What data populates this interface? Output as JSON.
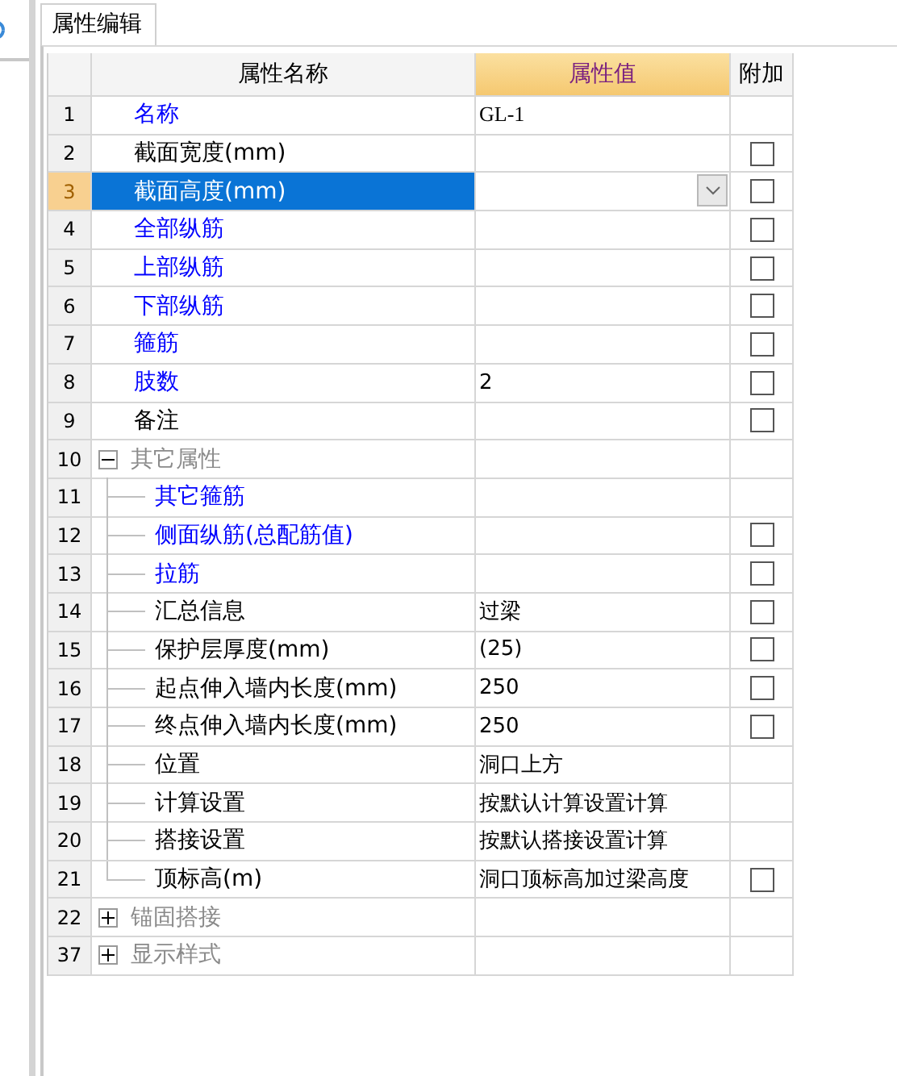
{
  "tab": {
    "label": "属性编辑",
    "selected": true
  },
  "table": {
    "columns": [
      {
        "label": "属性名称",
        "highlighted": false
      },
      {
        "label": "属性值",
        "highlighted": true
      },
      {
        "label": "附加",
        "highlighted": false
      }
    ],
    "rows": [
      {
        "kind": "item",
        "number": "1",
        "name": "名称",
        "color": "#0000ff",
        "value": "GL-1",
        "selected": false
      },
      {
        "kind": "item",
        "number": "2",
        "name": "截面宽度(mm)",
        "color": "#000000",
        "checked": false,
        "selected": false
      },
      {
        "kind": "item",
        "number": "3",
        "name": "截面高度(mm)",
        "checked": false,
        "selected": true,
        "dropdown": true
      },
      {
        "kind": "item",
        "number": "4",
        "name": "全部纵筋",
        "color": "#0000ff",
        "checked": false,
        "selected": false
      },
      {
        "kind": "item",
        "number": "5",
        "name": "上部纵筋",
        "color": "#0000ff",
        "checked": false,
        "selected": false
      },
      {
        "kind": "item",
        "number": "6",
        "name": "下部纵筋",
        "color": "#0000ff",
        "checked": false,
        "selected": false
      },
      {
        "kind": "item",
        "number": "7",
        "name": "箍筋",
        "color": "#0000ff",
        "checked": false,
        "selected": false
      },
      {
        "kind": "item",
        "number": "8",
        "name": "肢数",
        "color": "#0000ff",
        "value": "2",
        "checked": false,
        "selected": false
      },
      {
        "kind": "item",
        "number": "9",
        "name": "备注",
        "color": "#000000",
        "checked": false,
        "selected": false
      },
      {
        "kind": "group",
        "number": "10",
        "name": "其它属性",
        "expanded": true,
        "selected": false,
        "children": [
          {
            "kind": "item",
            "number": "11",
            "name": "其它箍筋",
            "color": "#0000ff",
            "selected": false
          },
          {
            "kind": "item",
            "number": "12",
            "name": "侧面纵筋(总配筋值)",
            "color": "#0000ff",
            "checked": false,
            "selected": false
          },
          {
            "kind": "item",
            "number": "13",
            "name": "拉筋",
            "color": "#0000ff",
            "checked": false,
            "selected": false
          },
          {
            "kind": "item",
            "number": "14",
            "name": "汇总信息",
            "color": "#000000",
            "value": "过梁",
            "checked": false,
            "selected": false
          },
          {
            "kind": "item",
            "number": "15",
            "name": "保护层厚度(mm)",
            "color": "#000000",
            "value": "(25)",
            "checked": false,
            "selected": false
          },
          {
            "kind": "item",
            "number": "16",
            "name": "起点伸入墙内长度(mm)",
            "color": "#000000",
            "value": "250",
            "checked": false,
            "selected": false
          },
          {
            "kind": "item",
            "number": "17",
            "name": "终点伸入墙内长度(mm)",
            "color": "#000000",
            "value": "250",
            "checked": false,
            "selected": false
          },
          {
            "kind": "item",
            "number": "18",
            "name": "位置",
            "color": "#000000",
            "value": "洞口上方",
            "selected": false
          },
          {
            "kind": "item",
            "number": "19",
            "name": "计算设置",
            "color": "#000000",
            "value": "按默认计算设置计算",
            "selected": false
          },
          {
            "kind": "item",
            "number": "20",
            "name": "搭接设置",
            "color": "#000000",
            "value": "按默认搭接设置计算",
            "selected": false
          },
          {
            "kind": "item",
            "number": "21",
            "name": "顶标高(m)",
            "color": "#000000",
            "value": "洞口顶标高加过梁高度",
            "checked": false,
            "selected": false
          }
        ]
      },
      {
        "kind": "group",
        "number": "22",
        "name": "锚固搭接",
        "expanded": false,
        "selected": false
      },
      {
        "kind": "group",
        "number": "37",
        "name": "显示样式",
        "expanded": false,
        "selected": false
      }
    ]
  }
}
